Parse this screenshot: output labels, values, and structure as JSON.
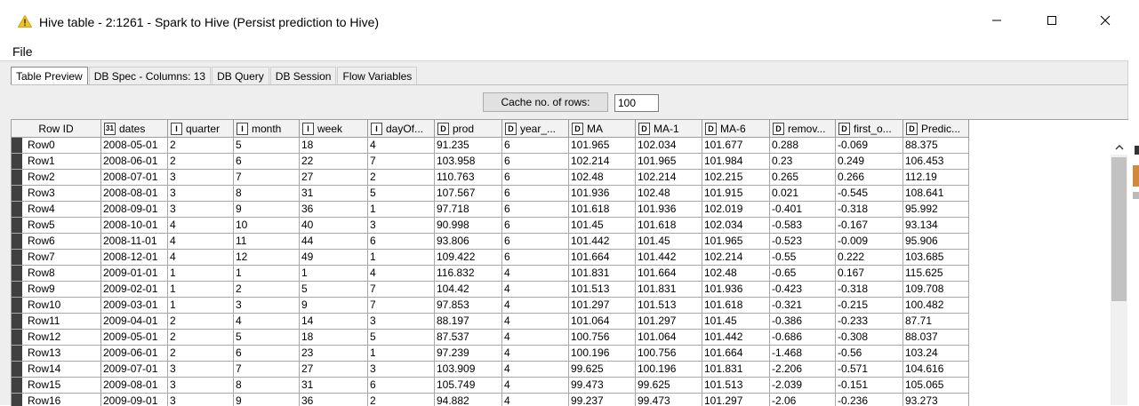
{
  "window": {
    "title": "Hive table - 2:1261 - Spark to Hive (Persist prediction to Hive)",
    "icon": "warning-triangle-icon",
    "controls": [
      "minimize-icon",
      "maximize-icon",
      "close-icon"
    ]
  },
  "menu": {
    "file": "File"
  },
  "tabs": [
    {
      "label": "Table Preview",
      "active": true
    },
    {
      "label": "DB Spec - Columns: 13",
      "active": false
    },
    {
      "label": "DB Query",
      "active": false
    },
    {
      "label": "DB Session",
      "active": false
    },
    {
      "label": "Flow Variables",
      "active": false
    }
  ],
  "cache": {
    "button_label": "Cache no. of rows:",
    "value": "100"
  },
  "table": {
    "row_id_header": "Row ID",
    "columns": [
      {
        "type": "31",
        "label": "dates"
      },
      {
        "type": "I",
        "label": "quarter"
      },
      {
        "type": "I",
        "label": "month"
      },
      {
        "type": "I",
        "label": "week"
      },
      {
        "type": "I",
        "label": "dayOf..."
      },
      {
        "type": "D",
        "label": "prod"
      },
      {
        "type": "D",
        "label": "year_..."
      },
      {
        "type": "D",
        "label": "MA"
      },
      {
        "type": "D",
        "label": "MA-1"
      },
      {
        "type": "D",
        "label": "MA-6"
      },
      {
        "type": "D",
        "label": "remov..."
      },
      {
        "type": "D",
        "label": "first_o..."
      },
      {
        "type": "D",
        "label": "Predic..."
      }
    ],
    "rows": [
      {
        "id": "Row0",
        "cells": [
          "2008-05-01",
          "2",
          "5",
          "18",
          "4",
          "91.235",
          "6",
          "101.965",
          "102.034",
          "101.677",
          "0.288",
          "-0.069",
          "88.375"
        ]
      },
      {
        "id": "Row1",
        "cells": [
          "2008-06-01",
          "2",
          "6",
          "22",
          "7",
          "103.958",
          "6",
          "102.214",
          "101.965",
          "101.984",
          "0.23",
          "0.249",
          "106.453"
        ]
      },
      {
        "id": "Row2",
        "cells": [
          "2008-07-01",
          "3",
          "7",
          "27",
          "2",
          "110.763",
          "6",
          "102.48",
          "102.214",
          "102.215",
          "0.265",
          "0.266",
          "112.19"
        ]
      },
      {
        "id": "Row3",
        "cells": [
          "2008-08-01",
          "3",
          "8",
          "31",
          "5",
          "107.567",
          "6",
          "101.936",
          "102.48",
          "101.915",
          "0.021",
          "-0.545",
          "108.641"
        ]
      },
      {
        "id": "Row4",
        "cells": [
          "2008-09-01",
          "3",
          "9",
          "36",
          "1",
          "97.718",
          "6",
          "101.618",
          "101.936",
          "102.019",
          "-0.401",
          "-0.318",
          "95.992"
        ]
      },
      {
        "id": "Row5",
        "cells": [
          "2008-10-01",
          "4",
          "10",
          "40",
          "3",
          "90.998",
          "6",
          "101.45",
          "101.618",
          "102.034",
          "-0.583",
          "-0.167",
          "93.134"
        ]
      },
      {
        "id": "Row6",
        "cells": [
          "2008-11-01",
          "4",
          "11",
          "44",
          "6",
          "93.806",
          "6",
          "101.442",
          "101.45",
          "101.965",
          "-0.523",
          "-0.009",
          "95.906"
        ]
      },
      {
        "id": "Row7",
        "cells": [
          "2008-12-01",
          "4",
          "12",
          "49",
          "1",
          "109.422",
          "6",
          "101.664",
          "101.442",
          "102.214",
          "-0.55",
          "0.222",
          "103.685"
        ]
      },
      {
        "id": "Row8",
        "cells": [
          "2009-01-01",
          "1",
          "1",
          "1",
          "4",
          "116.832",
          "4",
          "101.831",
          "101.664",
          "102.48",
          "-0.65",
          "0.167",
          "115.625"
        ]
      },
      {
        "id": "Row9",
        "cells": [
          "2009-02-01",
          "1",
          "2",
          "5",
          "7",
          "104.42",
          "4",
          "101.513",
          "101.831",
          "101.936",
          "-0.423",
          "-0.318",
          "109.708"
        ]
      },
      {
        "id": "Row10",
        "cells": [
          "2009-03-01",
          "1",
          "3",
          "9",
          "7",
          "97.853",
          "4",
          "101.297",
          "101.513",
          "101.618",
          "-0.321",
          "-0.215",
          "100.482"
        ]
      },
      {
        "id": "Row11",
        "cells": [
          "2009-04-01",
          "2",
          "4",
          "14",
          "3",
          "88.197",
          "4",
          "101.064",
          "101.297",
          "101.45",
          "-0.386",
          "-0.233",
          "87.71"
        ]
      },
      {
        "id": "Row12",
        "cells": [
          "2009-05-01",
          "2",
          "5",
          "18",
          "5",
          "87.537",
          "4",
          "100.756",
          "101.064",
          "101.442",
          "-0.686",
          "-0.308",
          "88.037"
        ]
      },
      {
        "id": "Row13",
        "cells": [
          "2009-06-01",
          "2",
          "6",
          "23",
          "1",
          "97.239",
          "4",
          "100.196",
          "100.756",
          "101.664",
          "-1.468",
          "-0.56",
          "103.24"
        ]
      },
      {
        "id": "Row14",
        "cells": [
          "2009-07-01",
          "3",
          "7",
          "27",
          "3",
          "103.909",
          "4",
          "99.625",
          "100.196",
          "101.831",
          "-2.206",
          "-0.571",
          "104.616"
        ]
      },
      {
        "id": "Row15",
        "cells": [
          "2009-08-01",
          "3",
          "8",
          "31",
          "6",
          "105.749",
          "4",
          "99.473",
          "99.625",
          "101.513",
          "-2.039",
          "-0.151",
          "105.065"
        ]
      },
      {
        "id": "Row16",
        "cells": [
          "2009-09-01",
          "3",
          "9",
          "36",
          "2",
          "94.882",
          "4",
          "99.237",
          "99.473",
          "101.297",
          "-2.06",
          "-0.236",
          "93.273"
        ]
      }
    ]
  },
  "colors": {
    "row_marker": "#404040",
    "tab_active": "#ffffff",
    "header_bg": "#f2f2f2"
  }
}
